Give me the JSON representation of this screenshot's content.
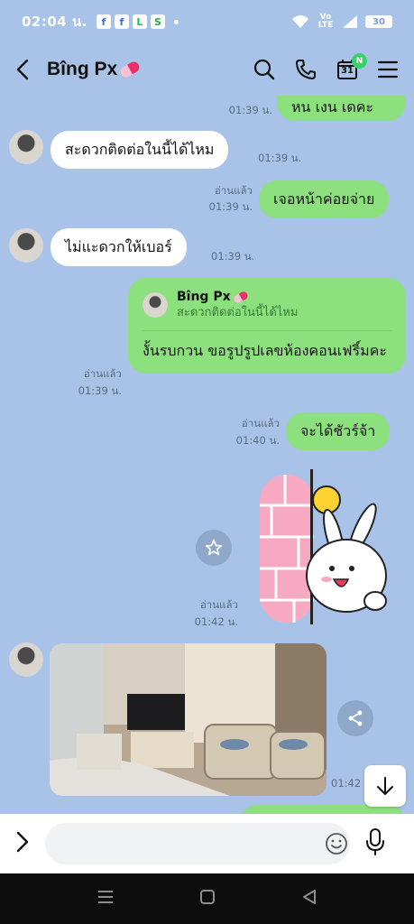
{
  "status_bar": {
    "time": "02:04 น.",
    "apps": [
      "f",
      "f",
      "L",
      "S"
    ],
    "network": "Vo LTE",
    "battery": "30"
  },
  "header": {
    "title": "Bîng Px",
    "calendar_day": "31",
    "calendar_badge": "N"
  },
  "messages": {
    "partial_top": {
      "text": "หน เงน เดคะ",
      "time": "01:39 น."
    },
    "m1": {
      "text": "สะดวกติดต่อในนี้ได้ไหม",
      "time": "01:39 น."
    },
    "m2": {
      "text": "เจอหน้าค่อยจ่าย",
      "read": "อ่านแล้ว",
      "time": "01:39 น."
    },
    "m3": {
      "text": "ไม่แะดวกให้เบอร์",
      "time": "01:39 น."
    },
    "m4": {
      "reply_name": "Bîng Px",
      "reply_text": "สะดวกติดต่อในนี้ได้ไหม",
      "text": "งั้นรบกวน ขอรูปรูปเลขห้องคอนเฟริ์มคะ",
      "read": "อ่านแล้ว",
      "time": "01:39 น."
    },
    "m5": {
      "text": "จะได้ชัวร์จ้า",
      "read": "อ่านแล้ว",
      "time": "01:40 น."
    },
    "sticker": {
      "read": "อ่านแล้ว",
      "time": "01:42 น."
    },
    "photo": {
      "time": "01:42"
    }
  },
  "input": {
    "placeholder": ""
  },
  "colors": {
    "background": "#a9c3e8",
    "outgoing": "#8de07e",
    "incoming": "#ffffff"
  }
}
